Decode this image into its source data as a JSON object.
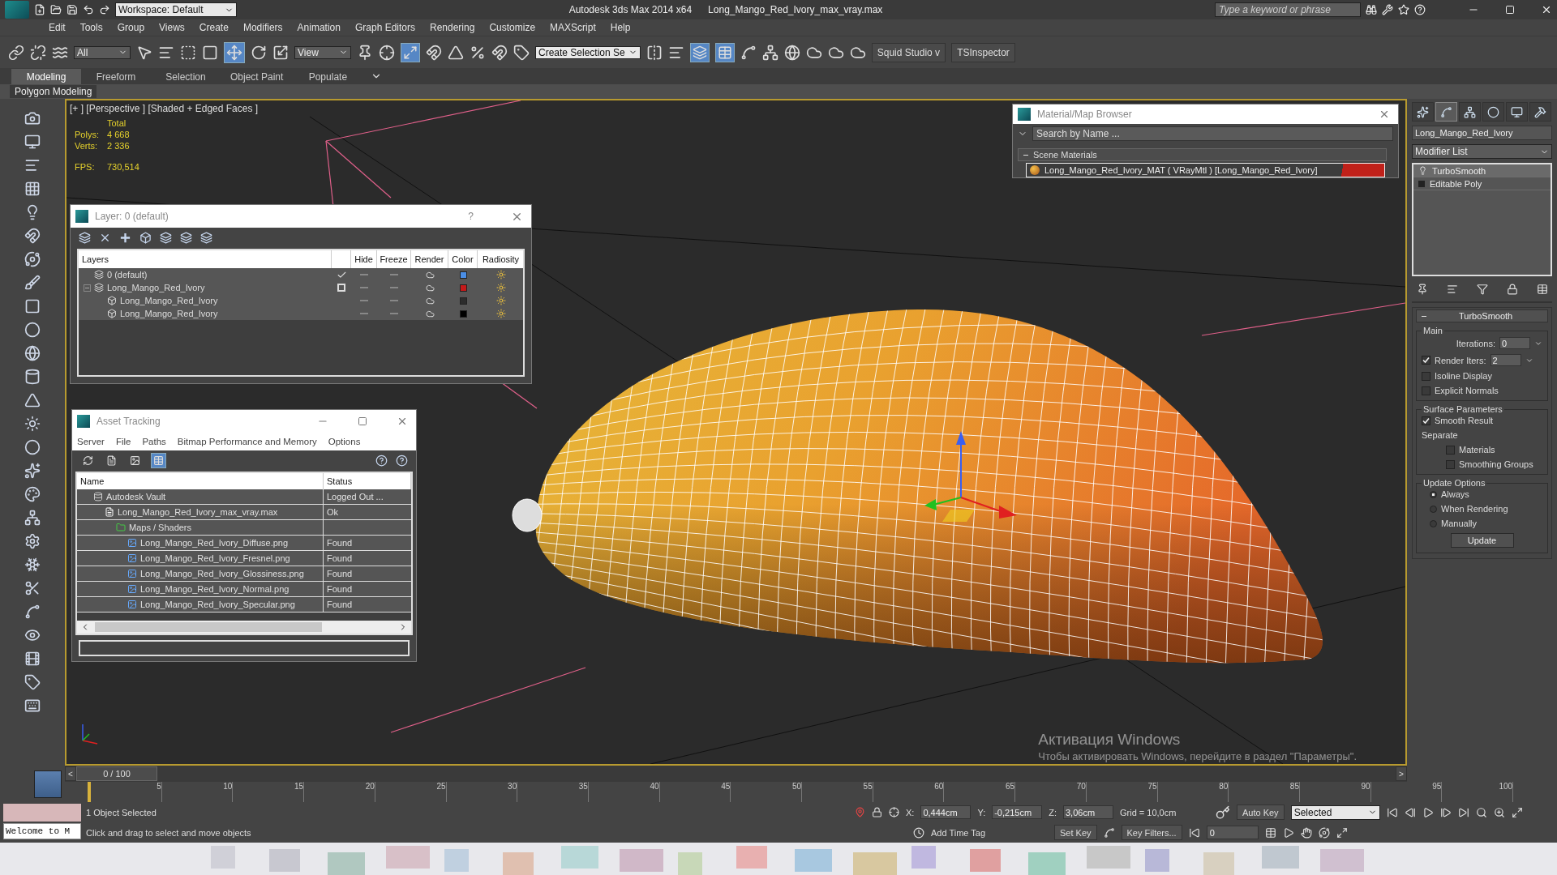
{
  "window": {
    "title": "Autodesk 3ds Max  2014 x64",
    "file": "Long_Mango_Red_Ivory_max_vray.max",
    "workspace": "Workspace: Default",
    "search": {
      "placeholder": "Type a keyword or phrase"
    }
  },
  "menu": [
    "Edit",
    "Tools",
    "Group",
    "Views",
    "Create",
    "Modifiers",
    "Animation",
    "Graph Editors",
    "Rendering",
    "Customize",
    "MAXScript",
    "Help"
  ],
  "toolbar": {
    "selection_filter": "All",
    "reference_coord": "View",
    "selection_set": "Create Selection Se",
    "extras": [
      "Squid Studio v",
      "TSInspector"
    ]
  },
  "ribbon": {
    "tabs": [
      {
        "label": "Modeling",
        "selected": true
      },
      {
        "label": "Freeform",
        "selected": false
      },
      {
        "label": "Selection",
        "selected": false
      },
      {
        "label": "Object Paint",
        "selected": false
      },
      {
        "label": "Populate",
        "selected": false
      }
    ],
    "panel": "Polygon Modeling"
  },
  "viewport": {
    "label": "[+ ] [Perspective ] [Shaded + Edged Faces ]",
    "stats": {
      "heading": "Total",
      "rows": [
        {
          "label": "Polys:",
          "value": "4 668"
        },
        {
          "label": "Verts:",
          "value": "2 336"
        },
        {
          "label": "FPS:",
          "value": "730,514"
        }
      ]
    }
  },
  "layer_dialog": {
    "title": "Layer: 0 (default)",
    "help": "?",
    "columns": [
      "Layers",
      "Hide",
      "Freeze",
      "Render",
      "Color",
      "Radiosity"
    ],
    "rows": [
      {
        "kind": "layer",
        "name": "0 (default)",
        "current": true,
        "color": "#4a8ee6"
      },
      {
        "kind": "layer",
        "name": "Long_Mango_Red_Ivory",
        "current": false,
        "expanded": true,
        "color": "#c41a1a",
        "children": [
          {
            "kind": "object",
            "name": "Long_Mango_Red_Ivory",
            "color": "#2c2c2c"
          },
          {
            "kind": "object",
            "name": "Long_Mango_Red_Ivory",
            "color": "#000000"
          }
        ]
      }
    ]
  },
  "asset_tracking": {
    "title": "Asset Tracking",
    "menu": [
      "Server",
      "File",
      "Paths",
      "Bitmap Performance and Memory",
      "Options"
    ],
    "view_modes": [
      {
        "selected": false
      },
      {
        "selected": false
      },
      {
        "selected": false
      },
      {
        "selected": true
      }
    ],
    "columns": [
      "Name",
      "Status"
    ],
    "rows": [
      {
        "kind": "vault",
        "name": "Autodesk Vault",
        "status": "Logged Out ...",
        "children": [
          {
            "kind": "file",
            "name": "Long_Mango_Red_Ivory_max_vray.max",
            "status": "Ok",
            "children": [
              {
                "kind": "folder",
                "name": "Maps / Shaders",
                "children": [
                  {
                    "kind": "image",
                    "name": "Long_Mango_Red_Ivory_Diffuse.png",
                    "status": "Found"
                  },
                  {
                    "kind": "image",
                    "name": "Long_Mango_Red_Ivory_Fresnel.png",
                    "status": "Found"
                  },
                  {
                    "kind": "image",
                    "name": "Long_Mango_Red_Ivory_Glossiness.png",
                    "status": "Found"
                  },
                  {
                    "kind": "image",
                    "name": "Long_Mango_Red_Ivory_Normal.png",
                    "status": "Found"
                  },
                  {
                    "kind": "image",
                    "name": "Long_Mango_Red_Ivory_Specular.png",
                    "status": "Found"
                  }
                ]
              }
            ]
          }
        ]
      }
    ]
  },
  "material_browser": {
    "title": "Material/Map Browser",
    "search": {
      "placeholder": "Search by Name ..."
    },
    "groups": [
      {
        "name": "Scene Materials",
        "expanded": true,
        "items": [
          {
            "name": "Long_Mango_Red_Ivory_MAT ( VRayMtl ) [Long_Mango_Red_Ivory]",
            "selected": true
          }
        ]
      }
    ]
  },
  "command_panel": {
    "tabs": [
      {
        "selected": false
      },
      {
        "selected": true
      },
      {
        "selected": false
      },
      {
        "selected": false
      },
      {
        "selected": false
      },
      {
        "selected": false
      }
    ],
    "object_name": "Long_Mango_Red_Ivory",
    "modifier_list": "Modifier List",
    "stack": [
      {
        "kind": "modifier",
        "name": "TurboSmooth",
        "selected": true
      },
      {
        "kind": "base",
        "name": "Editable Poly",
        "selected": false
      }
    ],
    "rollout": {
      "title": "TurboSmooth",
      "expanded": true,
      "groups": [
        {
          "title": "Main",
          "controls": [
            {
              "kind": "spinner",
              "label": "Iterations:",
              "value": "0"
            },
            {
              "kind": "checked_spinner",
              "label": "Render Iters:",
              "value": "2",
              "checked": true
            },
            {
              "kind": "checkbox",
              "label": "Isoline Display",
              "checked": false
            },
            {
              "kind": "checkbox",
              "label": "Explicit Normals",
              "checked": false
            }
          ]
        },
        {
          "title": "Surface Parameters",
          "controls": [
            {
              "kind": "checkbox",
              "label": "Smooth Result",
              "checked": true
            },
            {
              "kind": "label",
              "label": "Separate",
              "children": [
                {
                  "kind": "checkbox",
                  "label": "Materials",
                  "checked": false
                },
                {
                  "kind": "checkbox",
                  "label": "Smoothing Groups",
                  "checked": false
                }
              ]
            }
          ]
        },
        {
          "title": "Update Options",
          "controls": [
            {
              "kind": "radio",
              "label": "Always",
              "selected": true
            },
            {
              "kind": "radio",
              "label": "When Rendering",
              "selected": false
            },
            {
              "kind": "radio",
              "label": "Manually",
              "selected": false
            },
            {
              "kind": "button",
              "label": "Update"
            }
          ]
        }
      ]
    }
  },
  "timeline": {
    "slider": "0 / 100",
    "prev": "<",
    "next": ">",
    "level": 0,
    "ticks": [
      "5",
      "10",
      "15",
      "20",
      "25",
      "30",
      "35",
      "40",
      "45",
      "50",
      "55",
      "60",
      "65",
      "70",
      "75",
      "80",
      "85",
      "90",
      "95",
      "100"
    ]
  },
  "status": {
    "listener": "Welcome to M",
    "selection": "1 Object Selected",
    "prompt": "Click and drag to select and move objects",
    "coords": [
      {
        "axis": "X:",
        "value": "0,444cm"
      },
      {
        "axis": "Y:",
        "value": "-0,215cm"
      },
      {
        "axis": "Z:",
        "value": "3,06cm"
      }
    ],
    "grid": "Grid = 10,0cm",
    "add_time_tag": "Add Time Tag",
    "auto_key": "Auto Key",
    "set_key": "Set Key",
    "key_mode": "Selected",
    "key_filters": "Key Filters...",
    "frame": "0"
  },
  "activation": {
    "title": "Активация Windows",
    "message": "Чтобы активировать Windows, перейдите в раздел \"Параметры\"."
  }
}
